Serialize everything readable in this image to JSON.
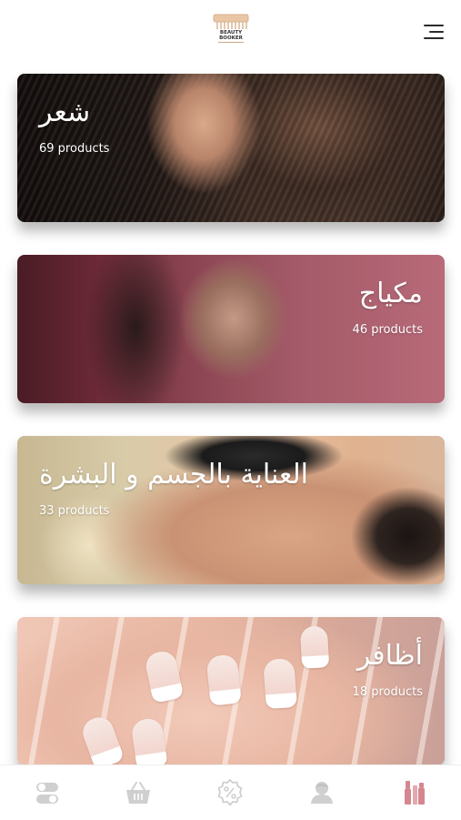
{
  "header": {
    "logo_line1": "BEAUTY",
    "logo_line2": "BOOKER",
    "menu_icon": "menu-icon"
  },
  "categories": [
    {
      "title": "شعر",
      "count": "69 products"
    },
    {
      "title": "مكياج",
      "count": "46 products"
    },
    {
      "title": "العناية بالجسم و البشرة",
      "count": "33 products"
    },
    {
      "title": "أظافر",
      "count": "18 products"
    }
  ],
  "tabbar": {
    "items": [
      {
        "icon": "toggle-icon"
      },
      {
        "icon": "basket-icon"
      },
      {
        "icon": "discount-icon"
      },
      {
        "icon": "profile-icon"
      },
      {
        "icon": "cosmetics-icon"
      }
    ],
    "active_color": "#d4878f",
    "inactive_color": "#c8c8c8"
  }
}
